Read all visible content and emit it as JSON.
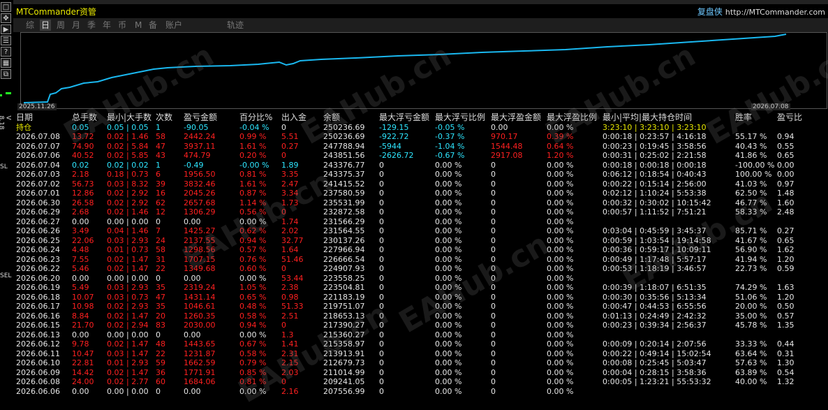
{
  "app": {
    "brand": "MTCommander资管",
    "author": "复盘侠",
    "url": "http://MTCommander.com"
  },
  "tabs": [
    "综",
    "日",
    "周",
    "月",
    "季",
    "年",
    "币",
    "M",
    "备",
    "账户",
    "轨迹"
  ],
  "active_tab": "日",
  "side": {
    "version": "V 8.18",
    "sl": "SL",
    "sel": "SEL",
    "btn_labels": [
      "□",
      "✥",
      "▶",
      "☰",
      "?",
      "▦",
      "⧉"
    ]
  },
  "watermark": "EAHub.cn",
  "chart": {
    "start_date": "2025.11.26",
    "end_date": "2026.07.08",
    "line_color": "#1ab8f0"
  },
  "columns": [
    "日期",
    "总手数",
    "最小|大手数",
    "次数",
    "盈亏金额",
    "百分比%",
    "出入金",
    "余额",
    "最大浮亏金额",
    "最大浮亏比例",
    "最大浮盈金额",
    "最大浮盈比例",
    "最小|平均|最大持仓时间",
    "胜率",
    "盈亏比"
  ],
  "colors": {
    "red": "#ff2020",
    "cyan": "#2ee6ff",
    "white": "#e6e6e6",
    "yellow": "#e8e800"
  },
  "rows": [
    {
      "c": "w",
      "v": [
        "持仓",
        "0.05",
        "0.05 | 0.05",
        "1",
        "-90.05",
        "-0.04 %",
        "0",
        "250236.69",
        "-129.15",
        "-0.05 %",
        "0.00",
        "0.00 %",
        "3:23:10 | 3:23:10 | 3:23:10",
        "",
        ""
      ],
      "cc": [
        "y",
        "c",
        "c",
        "c",
        "c",
        "c",
        "w",
        "w",
        "c",
        "c",
        "w",
        "w",
        "y",
        "w",
        "w"
      ]
    },
    {
      "c": "r",
      "v": [
        "2026.07.08",
        "13.72",
        "0.02 | 1.46",
        "58",
        "2442.24",
        "0.99 %",
        "5.51",
        "250236.69",
        "-922.72",
        "-0.37 %",
        "970.17",
        "0.39 %",
        "0:00:18 | 0:23:57 | 4:16:18",
        "55.17 %",
        "0.94"
      ]
    },
    {
      "c": "r",
      "v": [
        "2026.07.07",
        "74.90",
        "0.02 | 5.84",
        "47",
        "3937.11",
        "1.61 %",
        "0.27",
        "247788.94",
        "-5944",
        "-1.04 %",
        "1544.48",
        "0.64 %",
        "0:00:23 | 0:19:45 | 3:58:56",
        "40.43 %",
        "0.55"
      ]
    },
    {
      "c": "r",
      "v": [
        "2026.07.06",
        "40.52",
        "0.02 | 5.85",
        "43",
        "474.79",
        "0.20 %",
        "0",
        "243851.56",
        "-2626.72",
        "-0.67 %",
        "2917.08",
        "1.20 %",
        "0:00:31 | 0:25:02 | 2:21:58",
        "41.86 %",
        "0.65"
      ]
    },
    {
      "c": "c",
      "v": [
        "2026.07.04",
        "0.02",
        "0.02 | 0.02",
        "1",
        "-0.49",
        "-0.00 %",
        "1.89",
        "243376.77",
        "0",
        "0.00 %",
        "0",
        "0.00 %",
        "0:00:18 | 0:00:18 | 0:00:18",
        "-100.00 %",
        "0.00"
      ]
    },
    {
      "c": "r",
      "v": [
        "2026.07.03",
        "2.18",
        "0.18 | 0.73",
        "6",
        "1956.50",
        "0.81 %",
        "3.35",
        "243375.37",
        "0",
        "0.00 %",
        "0",
        "0.00 %",
        "0:06:12 | 0:18:54 | 0:40:43",
        "100.00 %",
        "0.00"
      ]
    },
    {
      "c": "r",
      "v": [
        "2026.07.02",
        "56.73",
        "0.03 | 8.32",
        "39",
        "3832.46",
        "1.61 %",
        "2.47",
        "241415.52",
        "0",
        "0.00 %",
        "0",
        "0.00 %",
        "0:00:22 | 0:15:14 | 2:56:00",
        "41.03 %",
        "0.97"
      ]
    },
    {
      "c": "r",
      "v": [
        "2026.07.01",
        "12.86",
        "0.02 | 2.92",
        "16",
        "2045.26",
        "0.87 %",
        "3.34",
        "237580.59",
        "0",
        "0.00 %",
        "0",
        "0.00 %",
        "0:02:12 | 1:10:24 | 5:53:38",
        "62.50 %",
        "1.48"
      ]
    },
    {
      "c": "r",
      "v": [
        "2026.06.30",
        "26.58",
        "0.02 | 2.92",
        "62",
        "2657.68",
        "1.14 %",
        "1.73",
        "235531.99",
        "0",
        "0.00 %",
        "0",
        "0.00 %",
        "0:00:32 | 0:30:02 | 10:15:42",
        "46.77 %",
        "1.60"
      ]
    },
    {
      "c": "r",
      "v": [
        "2026.06.29",
        "2.68",
        "0.02 | 1.46",
        "12",
        "1306.29",
        "0.56 %",
        "0",
        "232872.58",
        "0",
        "0.00 %",
        "0",
        "0.00 %",
        "0:00:57 | 1:11:52 | 7:51:21",
        "58.33 %",
        "2.48"
      ]
    },
    {
      "c": "w",
      "v": [
        "2026.06.27",
        "0.00",
        "0.00 | 0.00",
        "0",
        "0.00",
        "0.00 %",
        "1.74",
        "231566.29",
        "0",
        "0.00 %",
        "0",
        "0.00 %",
        "",
        "",
        ""
      ],
      "cc": [
        "w",
        "w",
        "w",
        "w",
        "w",
        "w",
        "r",
        "w",
        "w",
        "w",
        "w",
        "w",
        "w",
        "w",
        "w"
      ]
    },
    {
      "c": "r",
      "v": [
        "2026.06.26",
        "3.49",
        "0.04 | 1.46",
        "7",
        "1425.27",
        "0.62 %",
        "2.02",
        "231564.55",
        "0",
        "0.00 %",
        "0",
        "0.00 %",
        "0:03:04 | 0:45:59 | 3:45:37",
        "85.71 %",
        "0.27"
      ]
    },
    {
      "c": "r",
      "v": [
        "2026.06.25",
        "22.06",
        "0.03 | 2.93",
        "24",
        "2137.55",
        "0.94 %",
        "32.77",
        "230137.26",
        "0",
        "0.00 %",
        "0",
        "0.00 %",
        "0:00:59 | 1:03:54 | 19:14:58",
        "41.67 %",
        "0.65"
      ]
    },
    {
      "c": "r",
      "v": [
        "2026.06.24",
        "4.48",
        "0.01 | 0.73",
        "58",
        "1298.56",
        "0.57 %",
        "1.64",
        "227966.94",
        "0",
        "0.00 %",
        "0",
        "0.00 %",
        "0:00:36 | 0:59:17 | 10:09:11",
        "56.90 %",
        "1.62"
      ]
    },
    {
      "c": "r",
      "v": [
        "2026.06.23",
        "7.55",
        "0.02 | 1.47",
        "31",
        "1707.15",
        "0.76 %",
        "51.46",
        "226666.54",
        "0",
        "0.00 %",
        "0",
        "0.00 %",
        "0:00:49 | 1:17:48 | 5:57:17",
        "41.94 %",
        "1.20"
      ]
    },
    {
      "c": "r",
      "v": [
        "2026.06.22",
        "5.46",
        "0.02 | 1.47",
        "22",
        "1349.68",
        "0.60 %",
        "0",
        "224907.93",
        "0",
        "0.00 %",
        "0",
        "0.00 %",
        "0:00:53 | 1:18:19 | 3:46:57",
        "22.73 %",
        "0.59"
      ]
    },
    {
      "c": "w",
      "v": [
        "2026.06.20",
        "0.00",
        "0.00 | 0.00",
        "0",
        "0.00",
        "0.00 %",
        "53.44",
        "223558.25",
        "0",
        "0.00 %",
        "0",
        "0.00 %",
        "",
        "",
        ""
      ],
      "cc": [
        "w",
        "w",
        "w",
        "w",
        "w",
        "w",
        "r",
        "w",
        "w",
        "w",
        "w",
        "w",
        "w",
        "w",
        "w"
      ]
    },
    {
      "c": "r",
      "v": [
        "2026.06.19",
        "5.49",
        "0.03 | 2.93",
        "35",
        "2319.24",
        "1.05 %",
        "2.38",
        "223504.81",
        "0",
        "0.00 %",
        "0",
        "0.00 %",
        "0:00:39 | 1:18:07 | 6:51:35",
        "74.29 %",
        "1.63"
      ]
    },
    {
      "c": "r",
      "v": [
        "2026.06.18",
        "10.07",
        "0.03 | 0.73",
        "47",
        "1431.14",
        "0.65 %",
        "0.98",
        "221183.19",
        "0",
        "0.00 %",
        "0",
        "0.00 %",
        "0:00:30 | 0:35:56 | 5:13:34",
        "51.06 %",
        "1.20"
      ]
    },
    {
      "c": "r",
      "v": [
        "2026.06.17",
        "10.98",
        "0.02 | 2.93",
        "35",
        "1046.61",
        "0.48 %",
        "51.33",
        "219751.07",
        "0",
        "0.00 %",
        "0",
        "0.00 %",
        "0:00:47 | 0:44:53 | 6:55:56",
        "20.00 %",
        "0.50"
      ]
    },
    {
      "c": "r",
      "v": [
        "2026.06.16",
        "8.84",
        "0.02 | 1.47",
        "20",
        "1260.35",
        "0.58 %",
        "2.51",
        "218653.13",
        "0",
        "0.00 %",
        "0",
        "0.00 %",
        "0:01:13 | 0:24:49 | 2:42:32",
        "35.00 %",
        "0.57"
      ]
    },
    {
      "c": "r",
      "v": [
        "2026.06.15",
        "21.70",
        "0.02 | 2.94",
        "83",
        "2030.00",
        "0.94 %",
        "0",
        "217390.27",
        "0",
        "0.00 %",
        "0",
        "0.00 %",
        "0:00:23 | 0:39:34 | 2:56:37",
        "45.78 %",
        "1.35"
      ]
    },
    {
      "c": "w",
      "v": [
        "2026.06.13",
        "0.00",
        "0.00 | 0.00",
        "0",
        "0.00",
        "0.00 %",
        "1.3",
        "215360.27",
        "0",
        "0.00 %",
        "0",
        "0.00 %",
        "",
        "",
        ""
      ],
      "cc": [
        "w",
        "w",
        "w",
        "w",
        "w",
        "w",
        "r",
        "w",
        "w",
        "w",
        "w",
        "w",
        "w",
        "w",
        "w"
      ]
    },
    {
      "c": "r",
      "v": [
        "2026.06.12",
        "9.78",
        "0.02 | 1.47",
        "48",
        "1443.65",
        "0.67 %",
        "1.41",
        "215358.97",
        "0",
        "0.00 %",
        "0",
        "0.00 %",
        "0:00:09 | 0:20:14 | 2:07:56",
        "33.33 %",
        "0.44"
      ]
    },
    {
      "c": "r",
      "v": [
        "2026.06.11",
        "10.47",
        "0.03 | 1.47",
        "22",
        "1231.87",
        "0.58 %",
        "2.31",
        "213913.91",
        "0",
        "0.00 %",
        "0",
        "0.00 %",
        "0:00:22 | 0:49:14 | 15:02:54",
        "63.64 %",
        "0.31"
      ]
    },
    {
      "c": "r",
      "v": [
        "2026.06.10",
        "22.81",
        "0.01 | 2.93",
        "59",
        "1662.59",
        "0.79 %",
        "2.15",
        "212679.73",
        "0",
        "0.00 %",
        "0",
        "0.00 %",
        "0:00:08 | 0:25:45 | 5:03:47",
        "57.63 %",
        "1.30"
      ]
    },
    {
      "c": "r",
      "v": [
        "2026.06.09",
        "14.42",
        "0.02 | 1.47",
        "36",
        "1771.91",
        "0.85 %",
        "2.03",
        "211014.99",
        "0",
        "0.00 %",
        "0",
        "0.00 %",
        "0:00:04 | 0:28:15 | 3:58:36",
        "63.89 %",
        "0.54"
      ]
    },
    {
      "c": "r",
      "v": [
        "2026.06.08",
        "24.00",
        "0.02 | 2.77",
        "60",
        "1684.06",
        "0.81 %",
        "0",
        "209241.05",
        "0",
        "0.00 %",
        "0",
        "0.00 %",
        "0:00:05 | 1:23:21 | 55:53:32",
        "40.00 %",
        "1.32"
      ]
    },
    {
      "c": "w",
      "v": [
        "2026.06.06",
        "0.00",
        "0.00 | 0.00",
        "0",
        "0.00",
        "0.00 %",
        "2.16",
        "207556.99",
        "0",
        "0.00 %",
        "0",
        "0.00 %",
        "",
        "",
        ""
      ],
      "cc": [
        "w",
        "w",
        "w",
        "w",
        "w",
        "w",
        "r",
        "w",
        "w",
        "w",
        "w",
        "w",
        "w",
        "w",
        "w"
      ]
    }
  ]
}
